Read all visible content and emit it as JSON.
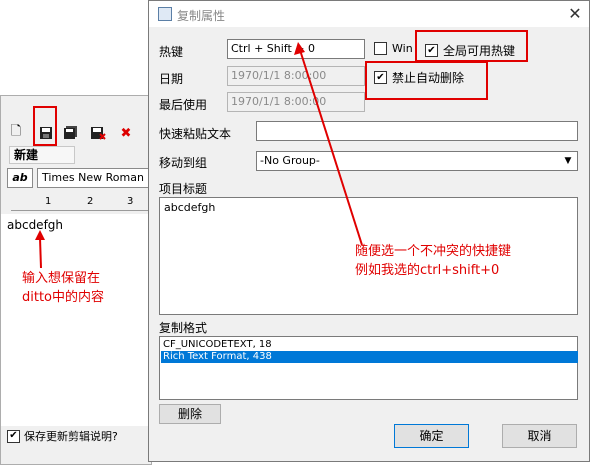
{
  "editor": {
    "tab_label": "新建",
    "style_button": "ab",
    "font_name": "Times New Roman",
    "ruler": [
      "1",
      "2",
      "3"
    ],
    "content_text": "abcdefgh",
    "save_check_label": "保存更新剪辑说明?"
  },
  "dialog": {
    "title": "复制属性",
    "close_glyph": "✕",
    "hotkey_label": "热键",
    "hotkey_value": "Ctrl + Shift + 0",
    "win_label": "Win",
    "global_hotkey_label": "全局可用热键",
    "date_label": "日期",
    "date_value": "1970/1/1 8:00:00",
    "last_used_label": "最后使用",
    "last_used_value": "1970/1/1 8:00:00",
    "no_auto_delete_label": "禁止自动删除",
    "quick_paste_label": "快速粘贴文本",
    "quick_paste_value": "",
    "move_to_group_label": "移动到组",
    "group_value": "-No Group-",
    "item_title_label": "项目标题",
    "item_title_value": "abcdefgh",
    "formats_label": "复制格式",
    "formats": [
      "CF_UNICODETEXT, 18",
      "Rich Text Format, 438"
    ],
    "selected_format_index": 1,
    "delete_button": "删除",
    "ok_button": "确定",
    "cancel_button": "取消"
  },
  "annotations": {
    "left_note_line1": "输入想保留在",
    "left_note_line2": "ditto中的内容",
    "right_note_line1": "随便选一个不冲突的快捷键",
    "right_note_line2": "例如我选的ctrl+shift+0"
  },
  "colors": {
    "annotation": "#e00000",
    "selection": "#0078d7",
    "dialog_bg": "#f0f0f0"
  }
}
